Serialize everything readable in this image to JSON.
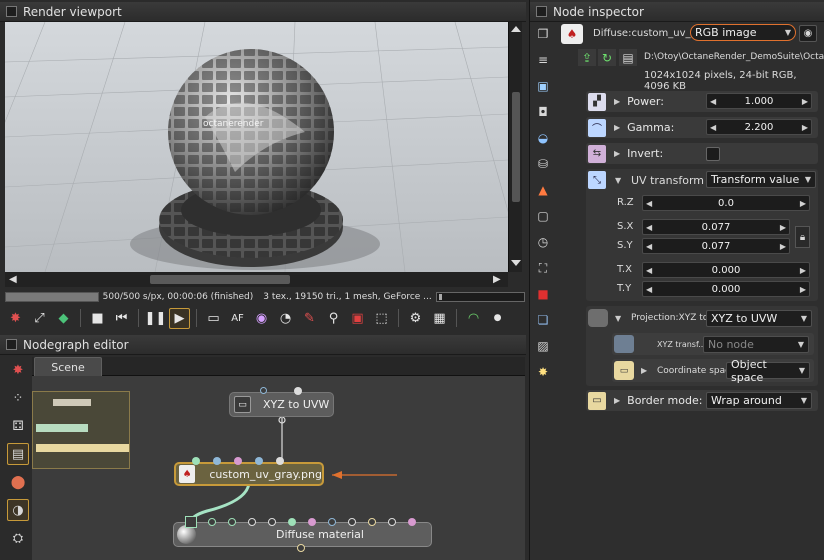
{
  "viewport_panel": {
    "title": "Render viewport"
  },
  "render_status": {
    "progress_pct": 100,
    "samples_text": "500/500 s/px, 00:00:06 (finished)",
    "scene_info": "3 tex., 19150 tri., 1 mesh, GeForce ..."
  },
  "render_scene": {
    "watermark": "octanerender"
  },
  "nodegraph_panel": {
    "title": "Nodegraph editor",
    "tab_label": "Scene"
  },
  "nodes": {
    "xyz": {
      "label": "XYZ to UVW"
    },
    "image": {
      "label": "custom_uv_gray.png"
    },
    "diffuse": {
      "label": "Diffuse material"
    }
  },
  "inspector": {
    "title": "Node inspector",
    "node_path": "Diffuse:custom_uv_gray...",
    "node_type": "RGB image",
    "file_path": "D:\\Otoy\\OctaneRender_DemoSuite\\Octane_R...",
    "file_info": "1024x1024 pixels, 24-bit RGB, 4096 KB",
    "power": {
      "label": "Power:",
      "value": "1.000"
    },
    "gamma": {
      "label": "Gamma:",
      "value": "2.200"
    },
    "invert": {
      "label": "Invert:"
    },
    "uv_transform": {
      "label": "UV transform",
      "mode": "Transform value",
      "rz": {
        "label": "R.Z",
        "value": "0.0"
      },
      "sx": {
        "label": "S.X",
        "value": "0.077"
      },
      "sy": {
        "label": "S.Y",
        "value": "0.077"
      },
      "tx": {
        "label": "T.X",
        "value": "0.000"
      },
      "ty": {
        "label": "T.Y",
        "value": "0.000"
      }
    },
    "projection": {
      "label": "Projection:XYZ to ...",
      "value": "XYZ to UVW",
      "xyz_transform_label": "XYZ transf...",
      "xyz_transform_value": "No node",
      "coord_space_label": "Coordinate space:",
      "coord_space_value": "Object space"
    },
    "border_mode": {
      "label": "Border mode:",
      "value": "Wrap around"
    }
  },
  "colors": {
    "accent": "#c79a3a",
    "highlight_ring": "#e0712e",
    "node_image": "#6b6340",
    "node_dark": "#5a5a5a"
  }
}
